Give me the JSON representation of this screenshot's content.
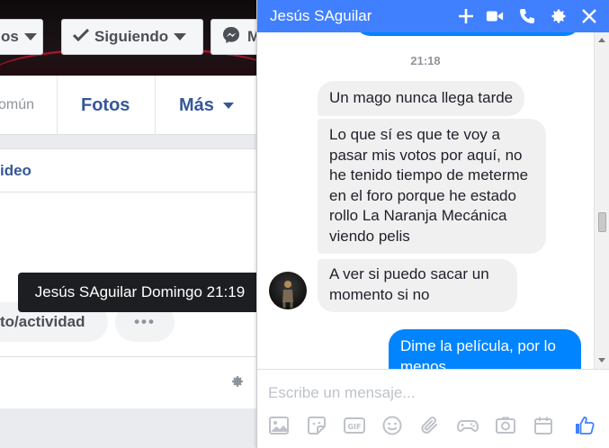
{
  "profile": {
    "partial_button": "os",
    "following_button": "Siguiendo",
    "message_button": "M",
    "tabs": {
      "common": "omún",
      "photos": "Fotos",
      "more": "Más"
    },
    "section_heading": "ideo",
    "activity_pill": "to/actividad",
    "more_pill": "•••",
    "tooltip": "Jesús SAguilar Domingo 21:19"
  },
  "chat": {
    "title": "Jesús SAguilar",
    "timestamp": "21:18",
    "messages": [
      {
        "from": "them",
        "text": "Un mago nunca llega tarde"
      },
      {
        "from": "them",
        "text": "Lo que sí es que te voy a pasar mis votos por aquí, no he tenido tiempo de meterme en el foro porque he estado rollo La Naranja Mecánica viendo pelis"
      },
      {
        "from": "them",
        "text": "A ver si puedo sacar un momento si no"
      },
      {
        "from": "me",
        "text": "Dime la película, por lo menos"
      }
    ],
    "composer_placeholder": "Escribe un mensaje...",
    "header_icons": [
      "add-icon",
      "video-call-icon",
      "phone-icon",
      "gear-icon",
      "close-icon"
    ],
    "tool_icons": [
      "image-icon",
      "sticker-icon",
      "gif-icon",
      "emoji-icon",
      "attachment-icon",
      "game-icon",
      "camera-icon",
      "calendar-icon",
      "like-icon"
    ]
  },
  "colors": {
    "messenger_blue": "#4080ff",
    "my_bubble": "#0084ff",
    "their_bubble": "#f1f0f0",
    "link_blue": "#365899"
  }
}
